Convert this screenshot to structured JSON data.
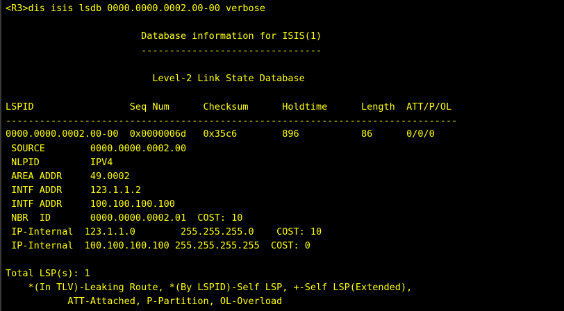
{
  "terminal": {
    "lines": [
      "<R3>dis isis lsdb 0000.0000.0002.00-00 verbose",
      "                        Database information for ISIS(1)",
      "                        --------------------------------",
      "                          Level-2 Link State Database",
      "LSPID                 Seq Num      Checksum      Holdtime      Length  ATT/P/OL",
      "--------------------------------------------------------------------------------",
      "0000.0000.0002.00-00  0x0000006d   0x35c6        896           86      0/0/0",
      " SOURCE        0000.0000.0002.00",
      " NLPID         IPV4",
      " AREA ADDR     49.0002",
      " INTF ADDR     123.1.1.2",
      " INTF ADDR     100.100.100.100",
      " NBR  ID       0000.0000.0002.01  COST: 10",
      " IP-Internal  123.1.1.0        255.255.255.0    COST: 10",
      " IP-Internal  100.100.100.100 255.255.255.255  COST: 0",
      "Total LSP(s): 1",
      "    *(In TLV)-Leaking Route, *(By LSPID)-Self LSP, +-Self LSP(Extended),",
      "           ATT-Attached, P-Partition, OL-Overload"
    ]
  },
  "colors": {
    "background": "#000000",
    "text": "#ffff00"
  }
}
